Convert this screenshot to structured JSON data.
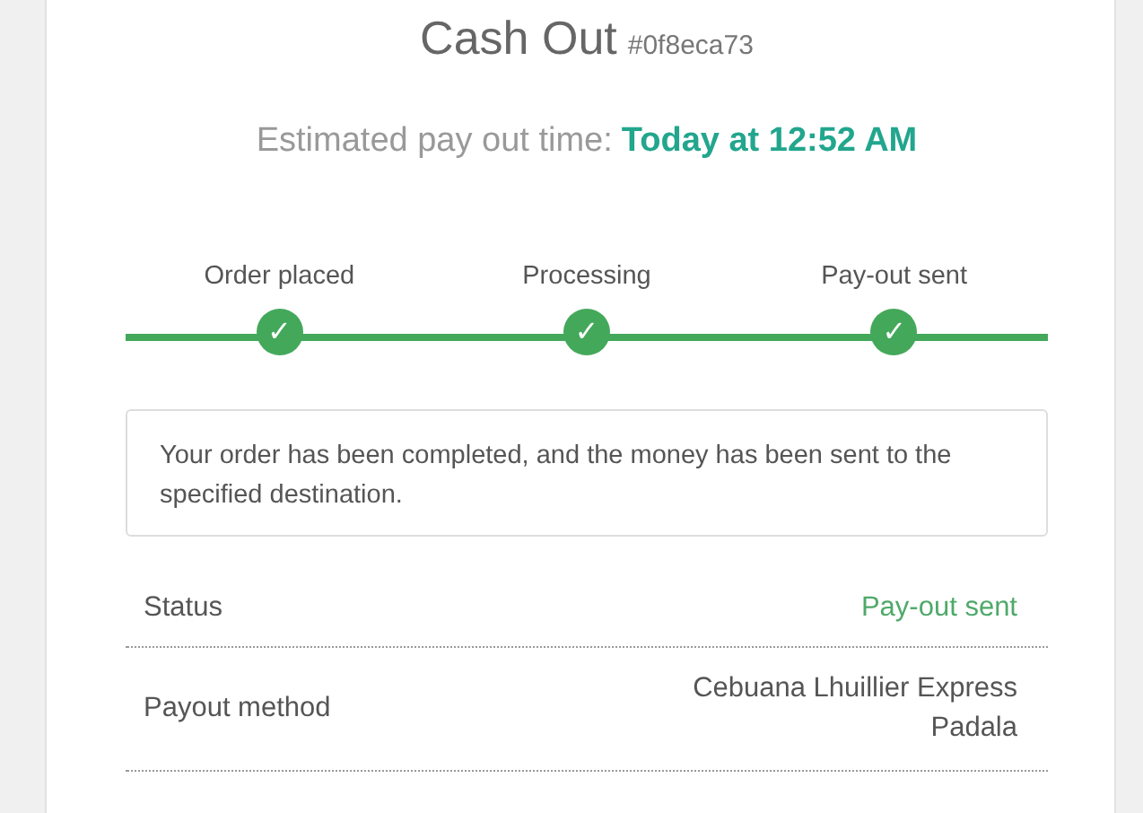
{
  "title": "Cash Out",
  "order_id": "#0f8eca73",
  "estimate": {
    "label": "Estimated pay out time:",
    "value": "Today at 12:52 AM"
  },
  "steps": [
    {
      "label": "Order placed",
      "completed": true,
      "mark": "✓"
    },
    {
      "label": "Processing",
      "completed": true,
      "mark": "✓"
    },
    {
      "label": "Pay-out sent",
      "completed": true,
      "mark": "✓"
    }
  ],
  "message": "Your order has been completed, and the money has been sent to the specified destination.",
  "details": [
    {
      "label": "Status",
      "value": "Pay-out sent",
      "color": "#4fa96a"
    },
    {
      "label": "Payout method",
      "value": "Cebuana Lhuillier Express Padala",
      "color": "#555555"
    }
  ]
}
